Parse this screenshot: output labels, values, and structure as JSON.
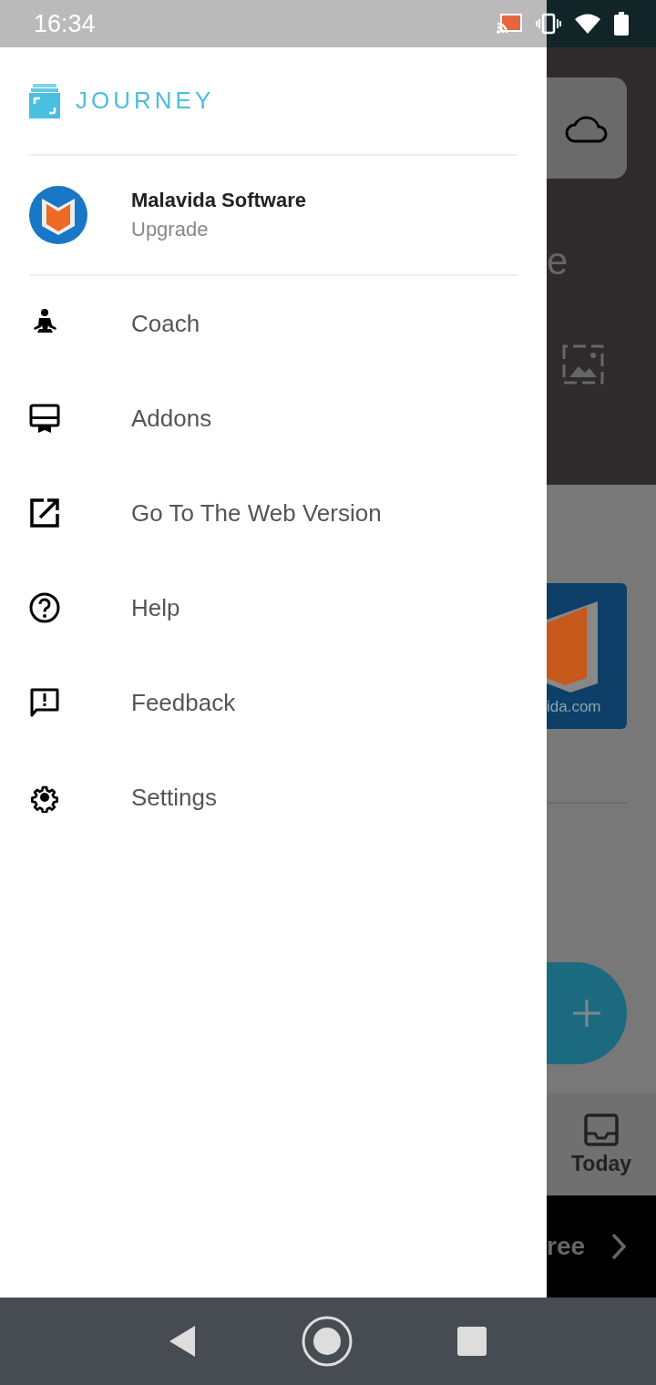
{
  "status_bar": {
    "time": "16:34"
  },
  "drawer": {
    "app_name": "JOURNEY",
    "account": {
      "name": "Malavida Software",
      "subtitle": "Upgrade"
    },
    "menu_items": [
      {
        "label": "Coach",
        "kind": "meditation"
      },
      {
        "label": "Addons",
        "kind": "addon"
      },
      {
        "label": "Go To The Web Version",
        "kind": "external"
      },
      {
        "label": "Help",
        "kind": "help"
      },
      {
        "label": "Feedback",
        "kind": "feedback"
      },
      {
        "label": "Settings",
        "kind": "settings"
      }
    ]
  },
  "background": {
    "heading_fragment": "e",
    "image_caption_fragment": "ida.com",
    "bottom_tab": "Today",
    "banner_fragment": "ree"
  }
}
